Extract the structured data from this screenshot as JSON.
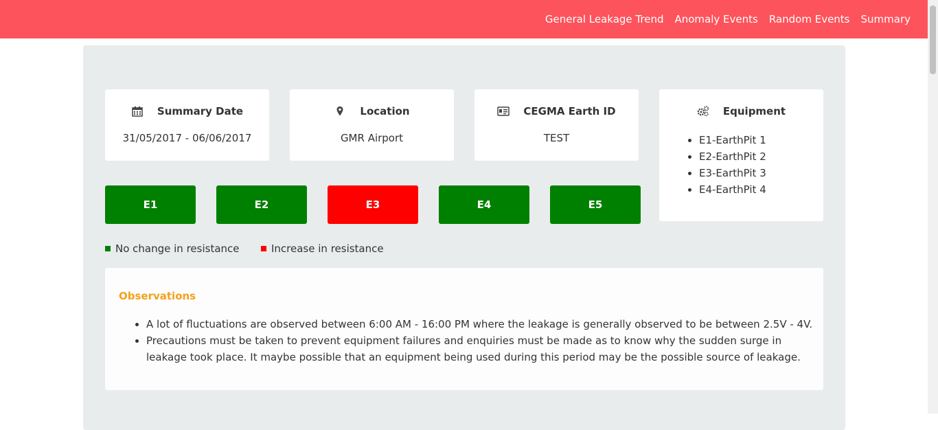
{
  "nav": {
    "links": [
      "General Leakage Trend",
      "Anomaly Events",
      "Random Events",
      "Summary"
    ]
  },
  "cards": {
    "summary_date": {
      "title": "Summary Date",
      "value": "31/05/2017 - 06/06/2017",
      "icon": "calendar-icon"
    },
    "location": {
      "title": "Location",
      "value": "GMR Airport",
      "icon": "map-marker-icon"
    },
    "earth_id": {
      "title": "CEGMA Earth ID",
      "value": "TEST",
      "icon": "id-card-icon"
    },
    "equipment": {
      "title": "Equipment",
      "icon": "gears-icon",
      "items": [
        "E1-EarthPit 1",
        "E2-EarthPit 2",
        "E3-EarthPit 3",
        "E4-EarthPit 4"
      ]
    }
  },
  "earth_pits": [
    {
      "label": "E1",
      "status": "no-change"
    },
    {
      "label": "E2",
      "status": "no-change"
    },
    {
      "label": "E3",
      "status": "increase"
    },
    {
      "label": "E4",
      "status": "no-change"
    },
    {
      "label": "E5",
      "status": "no-change"
    }
  ],
  "legend": {
    "no_change": "No change in resistance",
    "increase": "Increase in resistance"
  },
  "observations": {
    "title": "Observations",
    "items": [
      "A lot of fluctuations are observed between 6:00 AM - 16:00 PM where the leakage is generally observed to be between 2.5V - 4V.",
      "Precautions must be taken to prevent equipment failures and enquiries must be made as to know why the sudden surge in leakage took place. It maybe possible that an equipment being used during this period may be the possible source of leakage."
    ]
  },
  "colors": {
    "navbar": "#fd535c",
    "no_change": "#008000",
    "increase": "#ff0000",
    "observations_title": "#f4a11a"
  }
}
